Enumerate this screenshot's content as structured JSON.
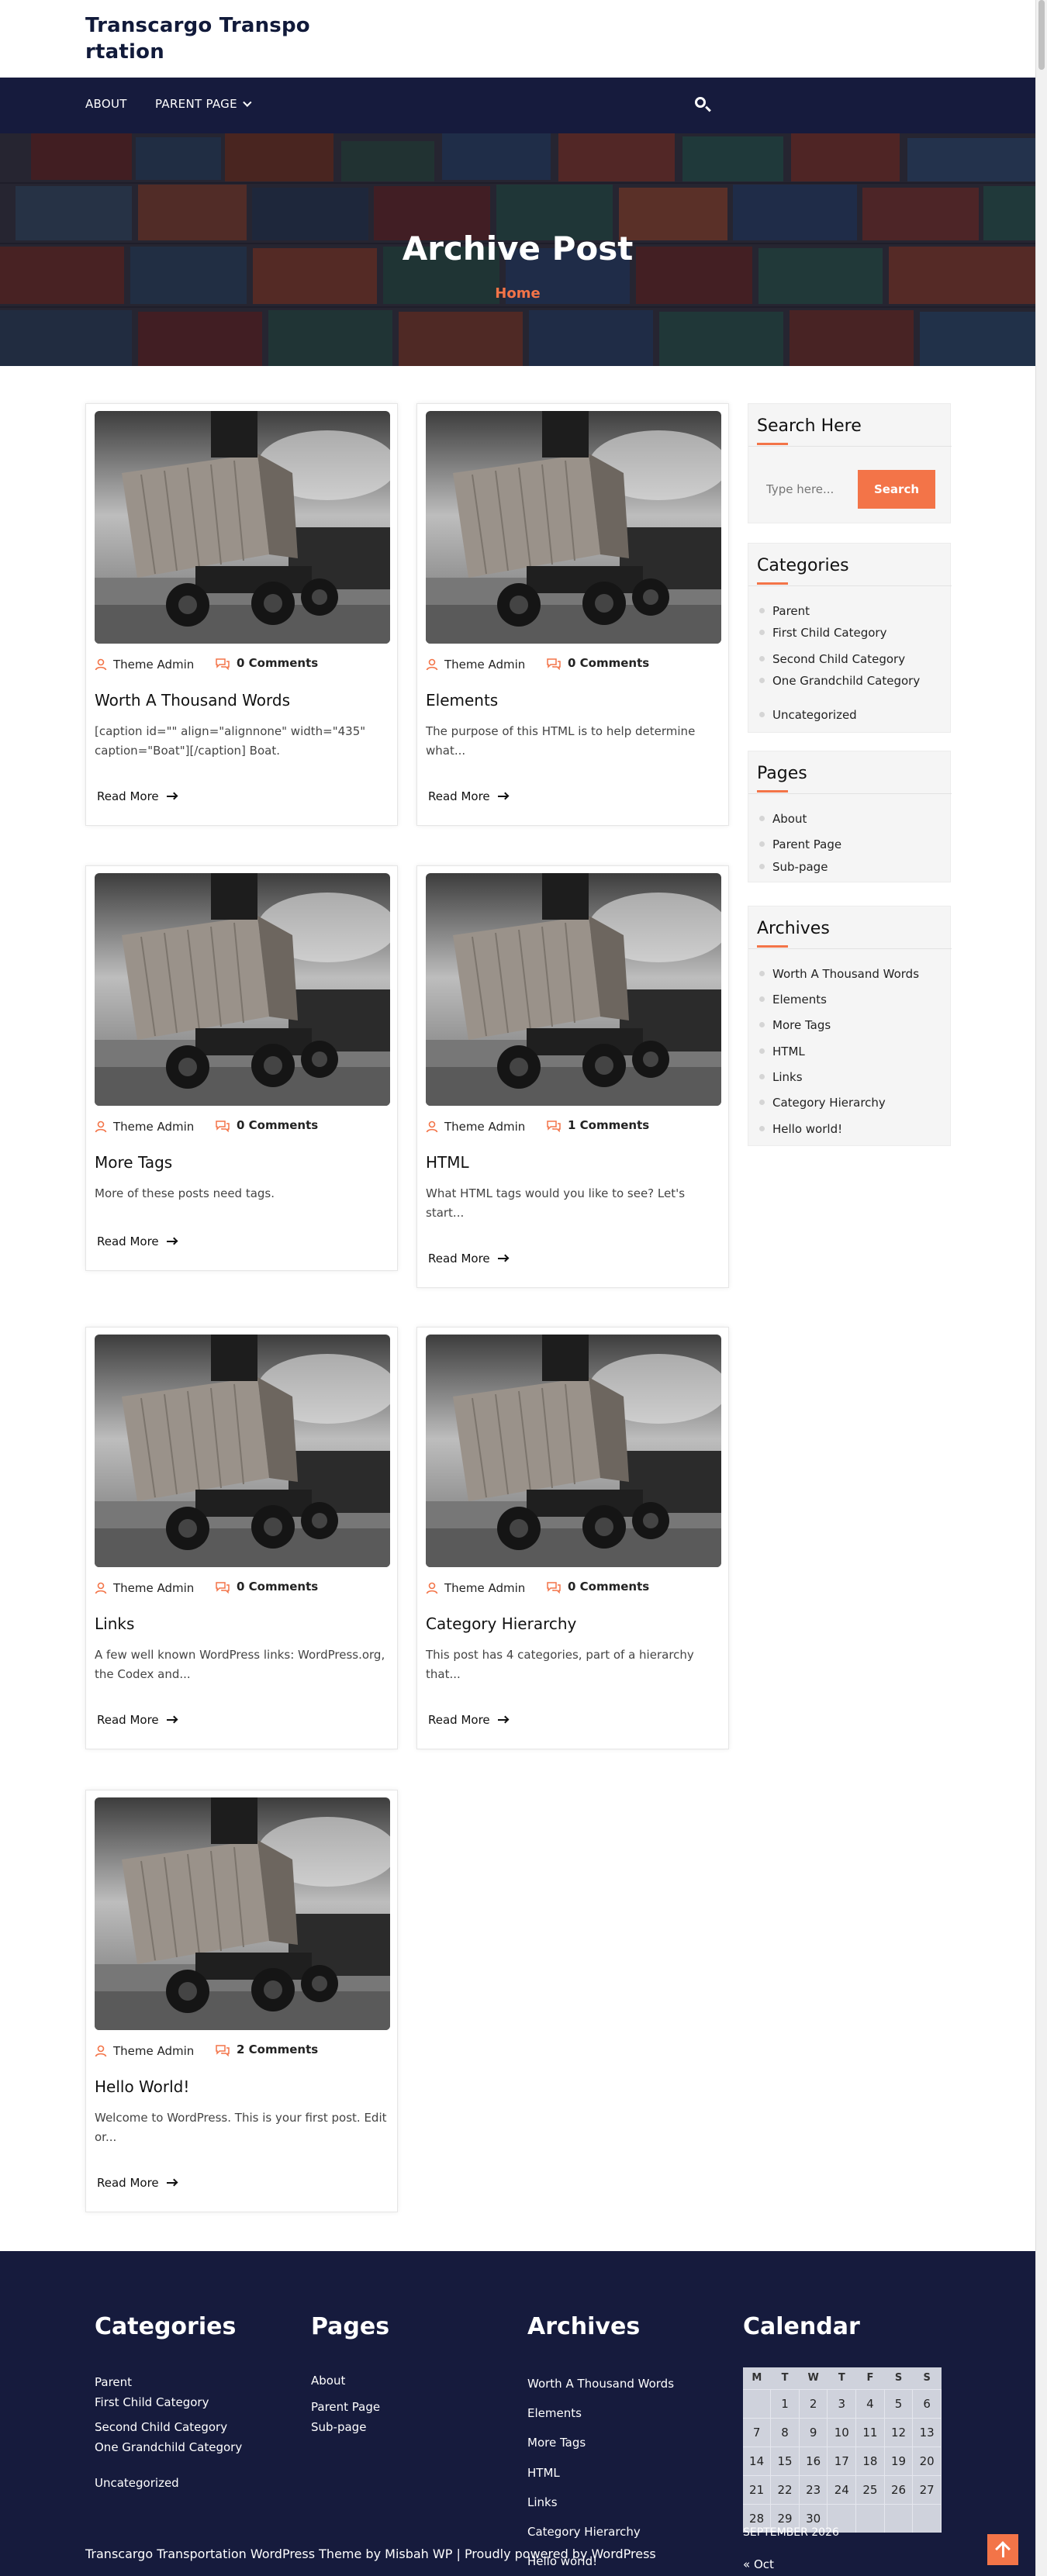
{
  "site": {
    "title": "Transcargo Transpo rtation"
  },
  "nav": {
    "about": "ABOUT",
    "parent_page": "PARENT PAGE"
  },
  "hero": {
    "title": "Archive Post",
    "breadcrumb": "Home"
  },
  "posts": [
    {
      "author": "Theme Admin",
      "comments": "0 Comments",
      "title": "Worth A Thousand Words",
      "excerpt": "[caption id=\"\" align=\"alignnone\" width=\"435\" caption=\"Boat\"][/caption] Boat.",
      "read_more": "Read More"
    },
    {
      "author": "Theme Admin",
      "comments": "0 Comments",
      "title": "Elements",
      "excerpt": "The purpose of this HTML is to help determine what...",
      "read_more": "Read More"
    },
    {
      "author": "Theme Admin",
      "comments": "0 Comments",
      "title": "More Tags",
      "excerpt": "More of these posts need tags.",
      "read_more": "Read More"
    },
    {
      "author": "Theme Admin",
      "comments": "1 Comments",
      "title": "HTML",
      "excerpt": "What HTML tags would you like to see? Let's start...",
      "read_more": "Read More"
    },
    {
      "author": "Theme Admin",
      "comments": "0 Comments",
      "title": "Links",
      "excerpt": "A few well known WordPress links: WordPress.org, the Codex and...",
      "read_more": "Read More"
    },
    {
      "author": "Theme Admin",
      "comments": "0 Comments",
      "title": "Category Hierarchy",
      "excerpt": "This post has 4 categories, part of a hierarchy that...",
      "read_more": "Read More"
    },
    {
      "author": "Theme Admin",
      "comments": "2 Comments",
      "title": "Hello World!",
      "excerpt": "Welcome to WordPress. This is your first post. Edit or...",
      "read_more": "Read More"
    }
  ],
  "sidebar": {
    "search": {
      "title": "Search Here",
      "placeholder": "Type here...",
      "button": "Search"
    },
    "categories": {
      "title": "Categories",
      "items": [
        "Parent",
        "First Child Category",
        "Second Child Category",
        "One Grandchild Category",
        "Uncategorized"
      ]
    },
    "pages": {
      "title": "Pages",
      "items": [
        "About",
        "Parent Page",
        "Sub-page"
      ]
    },
    "archives": {
      "title": "Archives",
      "items": [
        "Worth A Thousand Words",
        "Elements",
        "More Tags",
        "HTML",
        "Links",
        "Category Hierarchy",
        "Hello world!"
      ]
    }
  },
  "footer": {
    "categories": {
      "title": "Categories",
      "items": [
        "Parent",
        "First Child Category",
        "Second Child Category",
        "One Grandchild Category",
        "Uncategorized"
      ]
    },
    "pages": {
      "title": "Pages",
      "items": [
        "About",
        "Parent Page",
        "Sub-page"
      ]
    },
    "archives": {
      "title": "Archives",
      "items": [
        "Worth A Thousand Words",
        "Elements",
        "More Tags",
        "HTML",
        "Links",
        "Category Hierarchy",
        "Hello world!"
      ]
    },
    "calendar": {
      "title": "Calendar",
      "weekdays": [
        "M",
        "T",
        "W",
        "T",
        "F",
        "S",
        "S"
      ],
      "weeks": [
        [
          "",
          "1",
          "2",
          "3",
          "4",
          "5",
          "6"
        ],
        [
          "7",
          "8",
          "9",
          "10",
          "11",
          "12",
          "13"
        ],
        [
          "14",
          "15",
          "16",
          "17",
          "18",
          "19",
          "20"
        ],
        [
          "21",
          "22",
          "23",
          "24",
          "25",
          "26",
          "27"
        ],
        [
          "28",
          "29",
          "30",
          "",
          "",
          "",
          ""
        ]
      ],
      "caption": "SEPTEMBER 2026",
      "prev": "« Oct"
    },
    "copyright": "Transcargo Transportation WordPress Theme by Misbah WP | Proudly powered by WordPress"
  },
  "colors": {
    "navy": "#161b3d",
    "accent": "#f37448",
    "widget_bg": "#f5f5f5"
  },
  "icons": [
    "search-icon",
    "user-icon",
    "comment-icon",
    "arrow-right-icon",
    "chevron-down-icon",
    "arrow-up-icon"
  ]
}
